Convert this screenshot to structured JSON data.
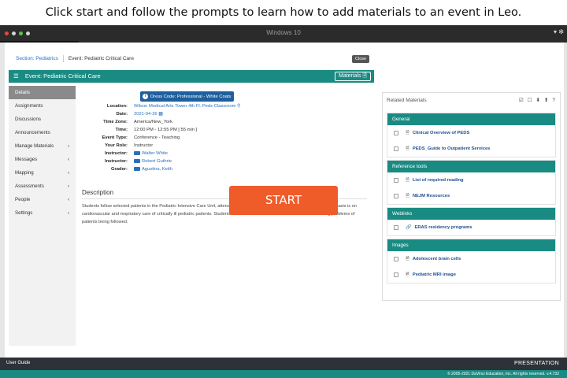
{
  "banner": {
    "text": "Click start and follow the prompts to learn how to add materials to an event in Leo."
  },
  "window": {
    "title": "Windows 10",
    "controls": "▾ ✻",
    "dot_colors": [
      "#e8473d",
      "#d4d4d4",
      "#5cc54a",
      "#d4d4d4"
    ]
  },
  "breadcrumb": {
    "section": "Section: Pediatrics",
    "event": "Event: Pediatric Critical Care"
  },
  "close_label": "Close",
  "header": {
    "title": "Event: Pediatric Critical Care",
    "materials_label": "Materials"
  },
  "sidebar": {
    "items": [
      {
        "label": "Details",
        "chevron": ""
      },
      {
        "label": "Assignments",
        "chevron": ""
      },
      {
        "label": "Discussions",
        "chevron": ""
      },
      {
        "label": "Announcements",
        "chevron": ""
      },
      {
        "label": "Manage Materials",
        "chevron": "‹"
      },
      {
        "label": "Messages",
        "chevron": "‹"
      },
      {
        "label": "Mapping",
        "chevron": "‹"
      },
      {
        "label": "Assessments",
        "chevron": "‹"
      },
      {
        "label": "People",
        "chevron": "‹"
      },
      {
        "label": "Settings",
        "chevron": "‹"
      }
    ]
  },
  "dress_code": "Dress Code: Professional - White Coats",
  "details": {
    "location": {
      "k": "Location:",
      "v": "Wilson Medical Arts Tower 4th Fl. Peds Classroom"
    },
    "date": {
      "k": "Date:",
      "v": "2021-04-26"
    },
    "time_zone": {
      "k": "Time Zone:",
      "v": "America/New_York"
    },
    "time": {
      "k": "Time:",
      "v": "12:00 PM - 12:55 PM [ 55 min ]"
    },
    "event_type": {
      "k": "Event Type:",
      "v": "Conference - Teaching"
    },
    "role": {
      "k": "Your Role:",
      "v": "Instructor"
    },
    "instructor1": {
      "k": "Instructor:",
      "v": "Walter White"
    },
    "instructor2": {
      "k": "Instructor:",
      "v": "Robert Guthrie"
    },
    "grader": {
      "k": "Grader:",
      "v": "Agustina, Keith"
    }
  },
  "description": {
    "heading": "Description",
    "text": "Students follow selected patients in the Pediatric Intensive Care Unit, attend management conferences, and teaching rounds. Emphasis is on cardiovascular and respiratory care of critically ill pediatric patients. Students become familiar with relevant literature concerning problems of patients being followed."
  },
  "start_label": "START",
  "related": {
    "title": "Related Materials",
    "tools": [
      "☑",
      "☐",
      "⬇",
      "⬆",
      "?"
    ],
    "sections": [
      {
        "name": "General",
        "items": [
          {
            "label": "Clinical Overview of PEDS",
            "icon": "file-icon",
            "glyph": "🗎"
          },
          {
            "label": "PEDS_Guide to Outpatient Services",
            "icon": "file-icon",
            "glyph": "🗎"
          }
        ]
      },
      {
        "name": "Reference tools",
        "items": [
          {
            "label": "List of required reading",
            "icon": "file-icon",
            "glyph": "🗎"
          },
          {
            "label": "NEJM Resources",
            "icon": "file-icon",
            "glyph": "🗎"
          }
        ]
      },
      {
        "name": "Weblinks",
        "items": [
          {
            "label": "ERAS residency programs",
            "icon": "link-icon",
            "glyph": "🔗"
          }
        ]
      },
      {
        "name": "Images",
        "items": [
          {
            "label": "Adolescent brain cells",
            "icon": "image-icon",
            "glyph": "🖻"
          },
          {
            "label": "Pediatric MRI image",
            "icon": "image-icon",
            "glyph": "🖻"
          }
        ]
      }
    ]
  },
  "bottom": {
    "user_guide": "User Guide",
    "presentation": "PRESENTATION"
  },
  "footer": {
    "copyright": "© 2005-2021 DaVinci Education, Inc. All rights reserved. v.4.732"
  },
  "colors": {
    "teal": "#1a8b82",
    "start": "#f05b2a",
    "link": "#2a6fbf"
  }
}
